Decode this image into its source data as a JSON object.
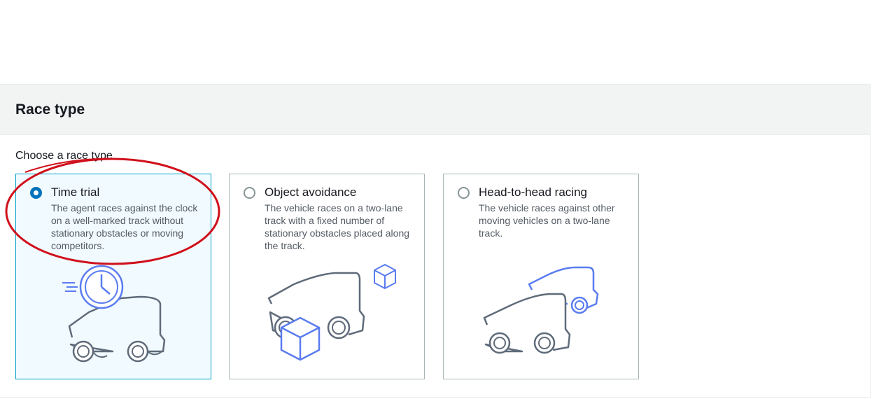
{
  "section": {
    "title": "Race type",
    "field_label": "Choose a race type"
  },
  "options": [
    {
      "title": "Time trial",
      "description": "The agent races against the clock on a well-marked track without stationary obstacles or moving competitors.",
      "selected": true,
      "illustration": "car-with-clock-icon"
    },
    {
      "title": "Object avoidance",
      "description": "The vehicle races on a two-lane track with a fixed number of stationary obstacles placed along the track.",
      "selected": false,
      "illustration": "car-with-boxes-icon"
    },
    {
      "title": "Head-to-head racing",
      "description": "The vehicle races against other moving vehicles on a two-lane track.",
      "selected": false,
      "illustration": "two-cars-icon"
    }
  ],
  "colors": {
    "accent_border": "#00a1c9",
    "selected_bg": "#f1faff",
    "radio_checked": "#0073bb",
    "illustration_stroke": "#5f6b7a",
    "illustration_accent": "#5a7cf0",
    "annotation": "#d0101b"
  }
}
